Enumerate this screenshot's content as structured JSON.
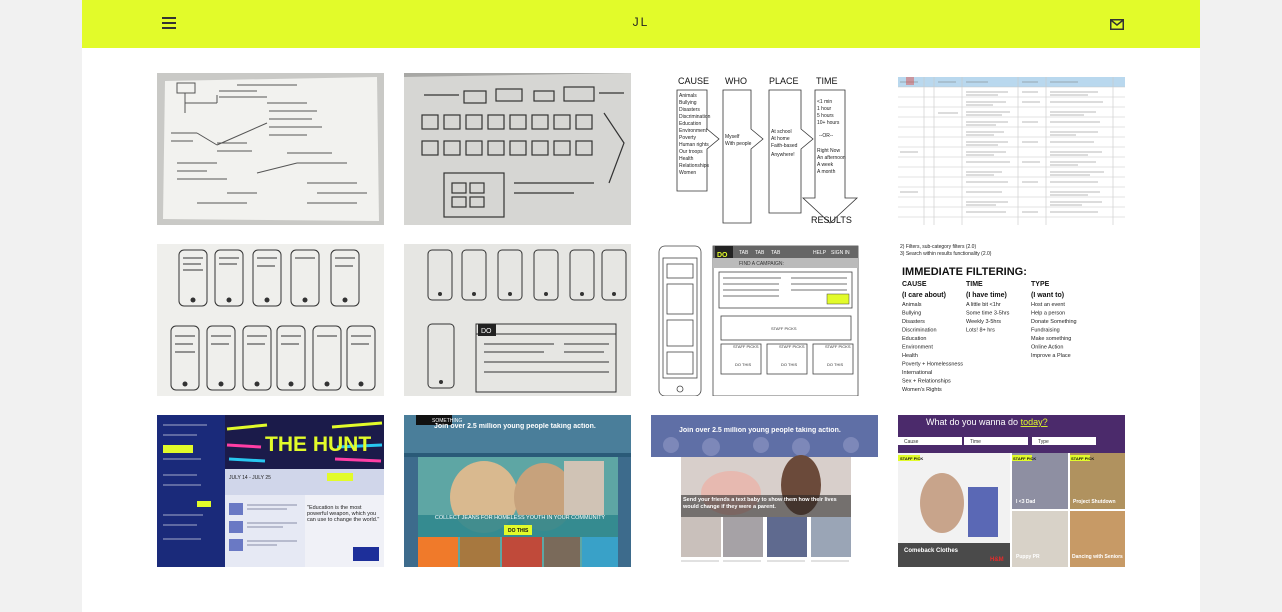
{
  "header": {
    "logo": "JL",
    "menu_icon": "hamburger-menu-icon",
    "mail_icon": "mail-envelope-icon",
    "background": "#e2fb2a"
  },
  "gallery": {
    "tiles": [
      {
        "name": "sketch-sitemap",
        "kind": "photo"
      },
      {
        "name": "sketch-wireframe-flow",
        "kind": "photo"
      },
      {
        "name": "diagram-cause-who-place-time",
        "kind": "diagram",
        "columns": [
          {
            "heading": "CAUSE",
            "items": [
              "Animals",
              "Bullying",
              "Disasters",
              "Discrimination",
              "Education",
              "Environment",
              "Poverty",
              "Human rights",
              "Our troops",
              "Health",
              "Relationships",
              "Women"
            ]
          },
          {
            "heading": "WHO",
            "items": [
              "Myself",
              "With people"
            ]
          },
          {
            "heading": "PLACE",
            "items": [
              "At school",
              "At home",
              "Faith-based",
              "Anywhere!"
            ]
          },
          {
            "heading": "TIME",
            "items": [
              "<1 min",
              "1 hour",
              "5 hours",
              "10+ hours",
              "--OR--",
              "Right Now",
              "An afternoon",
              "A week",
              "A month"
            ]
          }
        ],
        "result_label": "RESULTS"
      },
      {
        "name": "spreadsheet-user-stories",
        "kind": "document"
      },
      {
        "name": "sketch-mobile-screens",
        "kind": "photo"
      },
      {
        "name": "sketch-mobile-and-desktop",
        "kind": "photo"
      },
      {
        "name": "wireframe-desktop-mobile",
        "kind": "wireframe",
        "brand": "DO",
        "nav": [
          "TAB",
          "TAB",
          "TAB",
          "HELP",
          "SIGN IN"
        ],
        "find_label": "FIND A CAMPAIGN:",
        "staff_pick": "STAFF PICKS",
        "do_this": "DO THIS"
      },
      {
        "name": "immediate-filtering-notes",
        "kind": "document",
        "top_lines": [
          "2) Filters, sub-category filters (2.0)",
          "3) Search within results functionality (2.0)"
        ],
        "heading": "IMMEDIATE FILTERING:",
        "columns": [
          {
            "title": "CAUSE",
            "subtitle": "(I care about)",
            "items": [
              "Animals",
              "Bullying",
              "Disasters",
              "Discrimination",
              "Education",
              "Environment",
              "Health",
              "Poverty + Homelessness",
              "International",
              "Sex + Relationships",
              "Women's Rights"
            ]
          },
          {
            "title": "TIME",
            "subtitle": "(I have time)",
            "items": [
              "A little bit <1hr",
              "Some time 3-5hrs",
              "Weekly 3-5hrs",
              "Lots! 8+ hrs"
            ]
          },
          {
            "title": "TYPE",
            "subtitle": "(I want to)",
            "items": [
              "Host an event",
              "Help a person",
              "Donate Something",
              "Fundraising",
              "Make something",
              "Online Action",
              "Improve a Place"
            ]
          }
        ]
      },
      {
        "name": "mockup-the-hunt",
        "kind": "screenshot",
        "title": "THE HUNT",
        "date": "JULY 14 - JULY 25",
        "quote": "\"Education is the most powerful weapon, which you can use to change the world.\""
      },
      {
        "name": "mockup-jeans-campaign",
        "kind": "screenshot",
        "headline": "Join over 2.5 million young people taking action.",
        "banner": "COLLECT JEANS FOR HOMELESS YOUTH IN YOUR COMMUNITY",
        "button": "DO THIS"
      },
      {
        "name": "mockup-text-baby",
        "kind": "screenshot",
        "headline": "Join over 2.5 million young people taking action.",
        "banner": "Send your friends a text baby to show them how their lives would change if they were a parent."
      },
      {
        "name": "mockup-what-do-you-wanna-do",
        "kind": "screenshot",
        "headline_prefix": "What do you wanna do ",
        "headline_link": "today?",
        "filters": [
          "Cause",
          "Time",
          "Type"
        ],
        "badge": "STAFF PICK",
        "captions": [
          "Comeback Clothes",
          "I <3 Dad",
          "Project Shutdown",
          "Puppy PR",
          "Dancing with Seniors"
        ],
        "sponsor": "H&M"
      }
    ]
  }
}
